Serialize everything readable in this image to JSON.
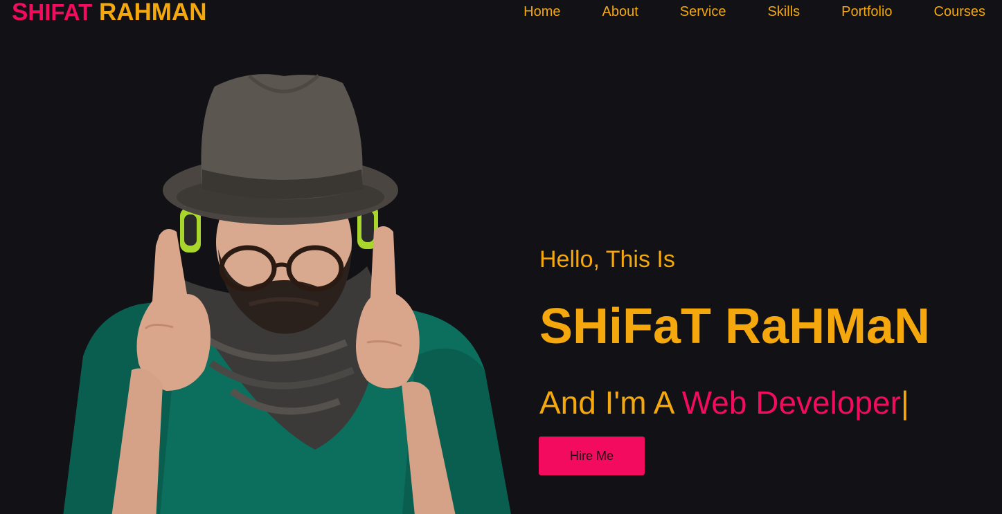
{
  "brand": {
    "first_initial": "S",
    "first_rest": "HIFAT",
    "last": " RAHMAN",
    "color_primary": "#f20b5f",
    "color_accent": "#f5a80d"
  },
  "nav": {
    "items": [
      "Home",
      "About",
      "Service",
      "Skills",
      "Portfolio",
      "Courses"
    ]
  },
  "hero": {
    "greeting": "Hello, This Is",
    "name": "SHiFaT RaHMaN",
    "role_prefix": "And I'm A ",
    "role_dynamic": "Web Developer",
    "role_cursor": "|",
    "cta_label": "Hire Me",
    "background_color": "#111116"
  }
}
